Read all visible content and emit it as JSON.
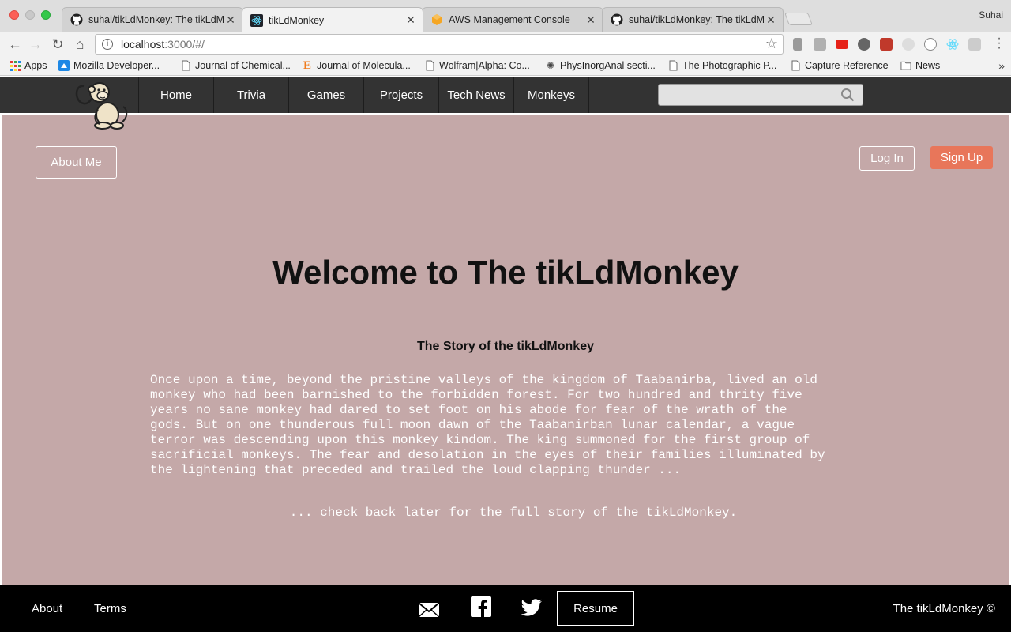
{
  "browser": {
    "tabs": [
      {
        "title": "suhai/tikLdMonkey: The tikLdM",
        "icon": "github-icon",
        "active": false
      },
      {
        "title": "tikLdMonkey",
        "icon": "react-icon",
        "active": true
      },
      {
        "title": "AWS Management Console",
        "icon": "aws-icon",
        "active": false
      },
      {
        "title": "suhai/tikLdMonkey: The tikLdM",
        "icon": "github-icon",
        "active": false
      }
    ],
    "profile_name": "Suhai",
    "url_host": "localhost",
    "url_rest": ":3000/#/",
    "bookmarks": [
      {
        "label": "Apps",
        "icon": "apps-grid-icon"
      },
      {
        "label": "Mozilla Developer...",
        "icon": "mdn-icon"
      },
      {
        "label": "Journal of Chemical...",
        "icon": "page-icon"
      },
      {
        "label": "Journal of Molecula...",
        "icon": "elsevier-icon"
      },
      {
        "label": "Wolfram|Alpha: Co...",
        "icon": "page-icon"
      },
      {
        "label": "PhysInorgAnal secti...",
        "icon": "spider-icon"
      },
      {
        "label": "The Photographic P...",
        "icon": "page-icon"
      },
      {
        "label": "Capture Reference",
        "icon": "page-icon"
      },
      {
        "label": "News",
        "icon": "folder-icon"
      }
    ]
  },
  "site": {
    "nav": [
      "Home",
      "Trivia",
      "Games",
      "Projects",
      "Tech News",
      "Monkeys"
    ],
    "search_placeholder": "",
    "about_label": "About Me",
    "login_label": "Log In",
    "signup_label": "Sign Up",
    "welcome": "Welcome to The tikLdMonkey",
    "story_title": "The Story of the tikLdMonkey",
    "story_lines": [
      "Once upon a time, beyond the pristine valleys of the kingdom of Taabanirba, lived an old",
      "monkey who had been barnished to the forbidden forest. For two hundred and thrity five",
      "years no sane monkey had dared to set foot on his abode for fear of the wrath of the",
      "gods. But on one thunderous full moon dawn of the Taabanirban lunar calendar, a vague",
      "terror was descending upon this monkey kindom. The king summoned for the first group of",
      "sacrificial monkeys. The fear and desolation in the eyes of their families illuminated by",
      "the lightening that preceded and trailed the loud clapping thunder ..."
    ],
    "story_more": "... check back later for the full story of the tikLdMonkey.",
    "colors": {
      "main_bg": "#c4a8a8",
      "nav_bg": "#333333",
      "signup": "#e8765a"
    }
  },
  "footer": {
    "about": "About",
    "terms": "Terms",
    "resume": "Resume",
    "copyright": "The tikLdMonkey ©",
    "icons": [
      "email-icon",
      "facebook-icon",
      "twitter-icon"
    ]
  }
}
